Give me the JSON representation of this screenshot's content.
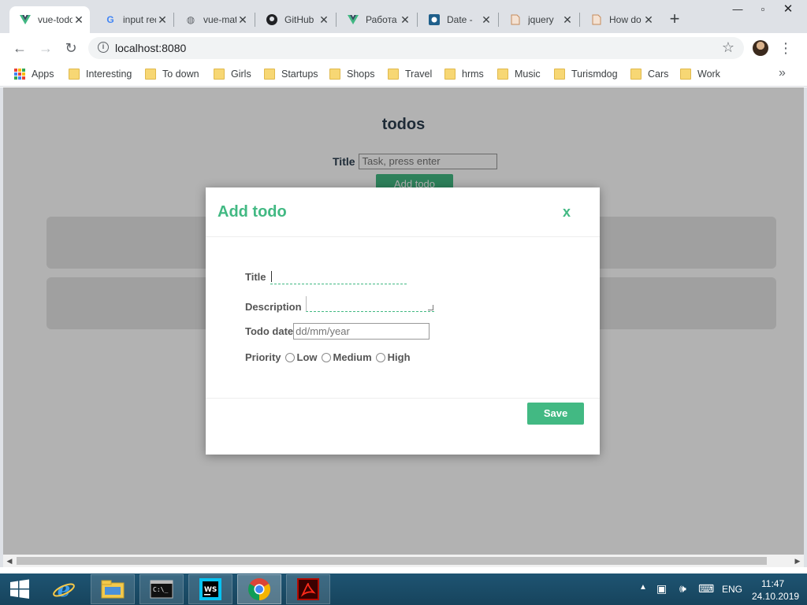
{
  "browser": {
    "tabs": [
      {
        "title": "vue-todo",
        "active": true,
        "icon": "vue-icon"
      },
      {
        "title": "input required",
        "active": false,
        "icon": "google-icon"
      },
      {
        "title": "vue-material",
        "active": false,
        "icon": "globe-icon"
      },
      {
        "title": "GitHub",
        "active": false,
        "icon": "github-icon"
      },
      {
        "title": "Работа",
        "active": false,
        "icon": "vue-icon"
      },
      {
        "title": "Date - ",
        "active": false,
        "icon": "mdn-icon"
      },
      {
        "title": "jquery",
        "active": false,
        "icon": "doc-icon"
      },
      {
        "title": "How do",
        "active": false,
        "icon": "doc-icon"
      }
    ],
    "url": "localhost:8080",
    "bookmarks": [
      {
        "label": "Apps",
        "icon": "apps-grid-icon"
      },
      {
        "label": "Interesting",
        "icon": "folder-icon"
      },
      {
        "label": "To down",
        "icon": "folder-icon"
      },
      {
        "label": "Girls",
        "icon": "folder-icon"
      },
      {
        "label": "Startups",
        "icon": "folder-icon"
      },
      {
        "label": "Shops",
        "icon": "folder-icon"
      },
      {
        "label": "Travel",
        "icon": "folder-icon"
      },
      {
        "label": "hrms",
        "icon": "folder-icon"
      },
      {
        "label": "Music",
        "icon": "folder-icon"
      },
      {
        "label": "Turismdog",
        "icon": "folder-icon"
      },
      {
        "label": "Cars",
        "icon": "folder-icon"
      },
      {
        "label": "Work",
        "icon": "folder-icon"
      }
    ],
    "more_glyph": "»"
  },
  "page": {
    "title": "todos",
    "title_label": "Title",
    "title_placeholder": "Task, press enter",
    "add_button": "Add todo"
  },
  "modal": {
    "heading": "Add todo",
    "close": "x",
    "fields": {
      "title_label": "Title",
      "description_label": "Description",
      "date_label": "Todo date",
      "date_placeholder": "dd/mm/year",
      "priority_label": "Priority",
      "priority_options": [
        "Low",
        "Medium",
        "High"
      ]
    },
    "save_label": "Save"
  },
  "taskbar": {
    "apps": [
      "start",
      "internet-explorer",
      "file-explorer",
      "command-prompt",
      "webstorm",
      "chrome",
      "acrobat"
    ],
    "lang": "ENG",
    "time": "11:47",
    "date": "24.10.2019"
  },
  "colors": {
    "accent": "#42b983",
    "heading": "#2c3e50"
  }
}
